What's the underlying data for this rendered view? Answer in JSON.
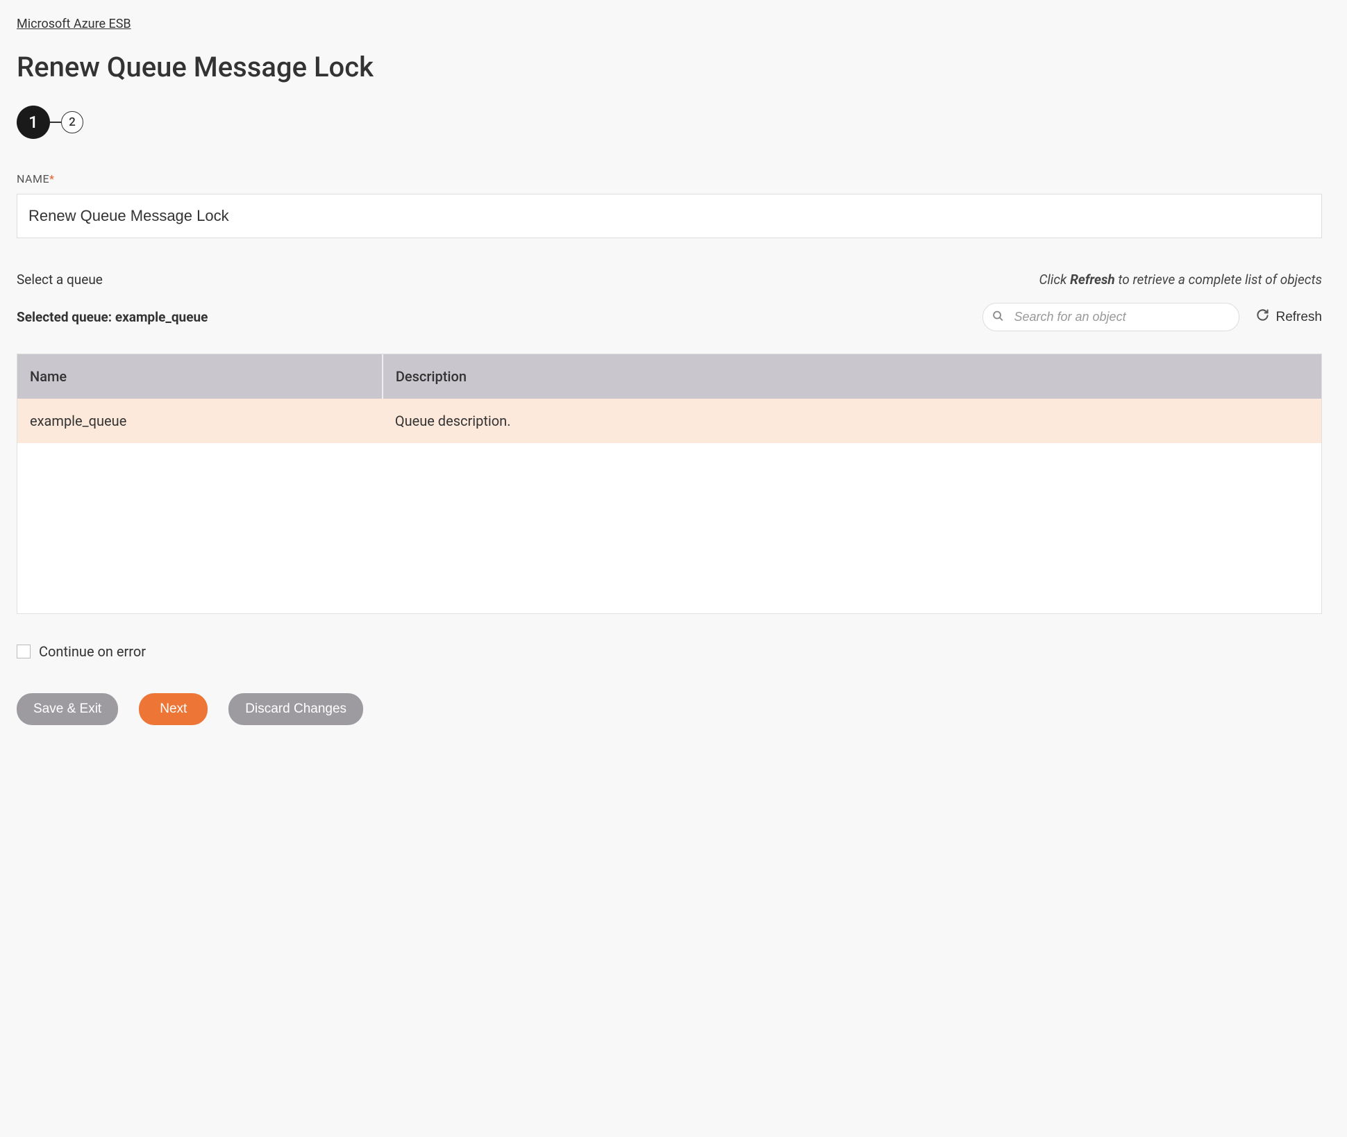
{
  "breadcrumb": "Microsoft Azure ESB",
  "page_title": "Renew Queue Message Lock",
  "stepper": {
    "step1": "1",
    "step2": "2"
  },
  "form": {
    "name_label": "NAME",
    "name_value": "Renew Queue Message Lock"
  },
  "queue_section": {
    "select_label": "Select a queue",
    "hint_prefix": "Click ",
    "hint_bold": "Refresh",
    "hint_suffix": " to retrieve a complete list of objects",
    "selected_prefix": "Selected queue: ",
    "selected_value": "example_queue",
    "search_placeholder": "Search for an object",
    "refresh_label": "Refresh"
  },
  "table": {
    "headers": {
      "name": "Name",
      "description": "Description"
    },
    "rows": [
      {
        "name": "example_queue",
        "description": "Queue description."
      }
    ]
  },
  "continue_on_error_label": "Continue on error",
  "buttons": {
    "save_exit": "Save & Exit",
    "next": "Next",
    "discard": "Discard Changes"
  }
}
